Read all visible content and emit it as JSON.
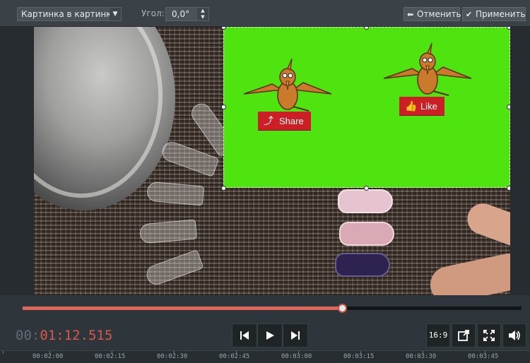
{
  "toolbar": {
    "mode_select_value": "Картинка в картинке",
    "angle_label": "Угол:",
    "angle_value": "0,0°",
    "cancel_label": "Отменить",
    "apply_label": "Применить"
  },
  "overlay": {
    "share_label": "Share",
    "like_label": "Like",
    "background_color": "#4fe40f",
    "badge_color": "#cc1f25"
  },
  "playback": {
    "progress": 0.64,
    "timecode_prefix": "00:",
    "timecode_value": "01:12.515",
    "aspect_label": "16:9",
    "accent_color": "#e0665a"
  },
  "ruler": {
    "labels": [
      "00:02:00",
      "00:02:15",
      "00:02:30",
      "00:02:45",
      "00:03:00",
      "00:03:15",
      "00:03:30",
      "00:03:45"
    ]
  },
  "icons": {
    "mode_select": "chevron-down-icon",
    "angle": "spinner-arrows-icon",
    "cancel": "undo-arrow-icon",
    "apply": "checkmark-icon",
    "prev": "skip-previous-icon",
    "play": "play-icon",
    "next": "skip-next-icon",
    "aspect": "aspect-ratio-icon",
    "popout": "external-window-icon",
    "fullscreen": "fullscreen-icon",
    "volume": "volume-icon"
  }
}
